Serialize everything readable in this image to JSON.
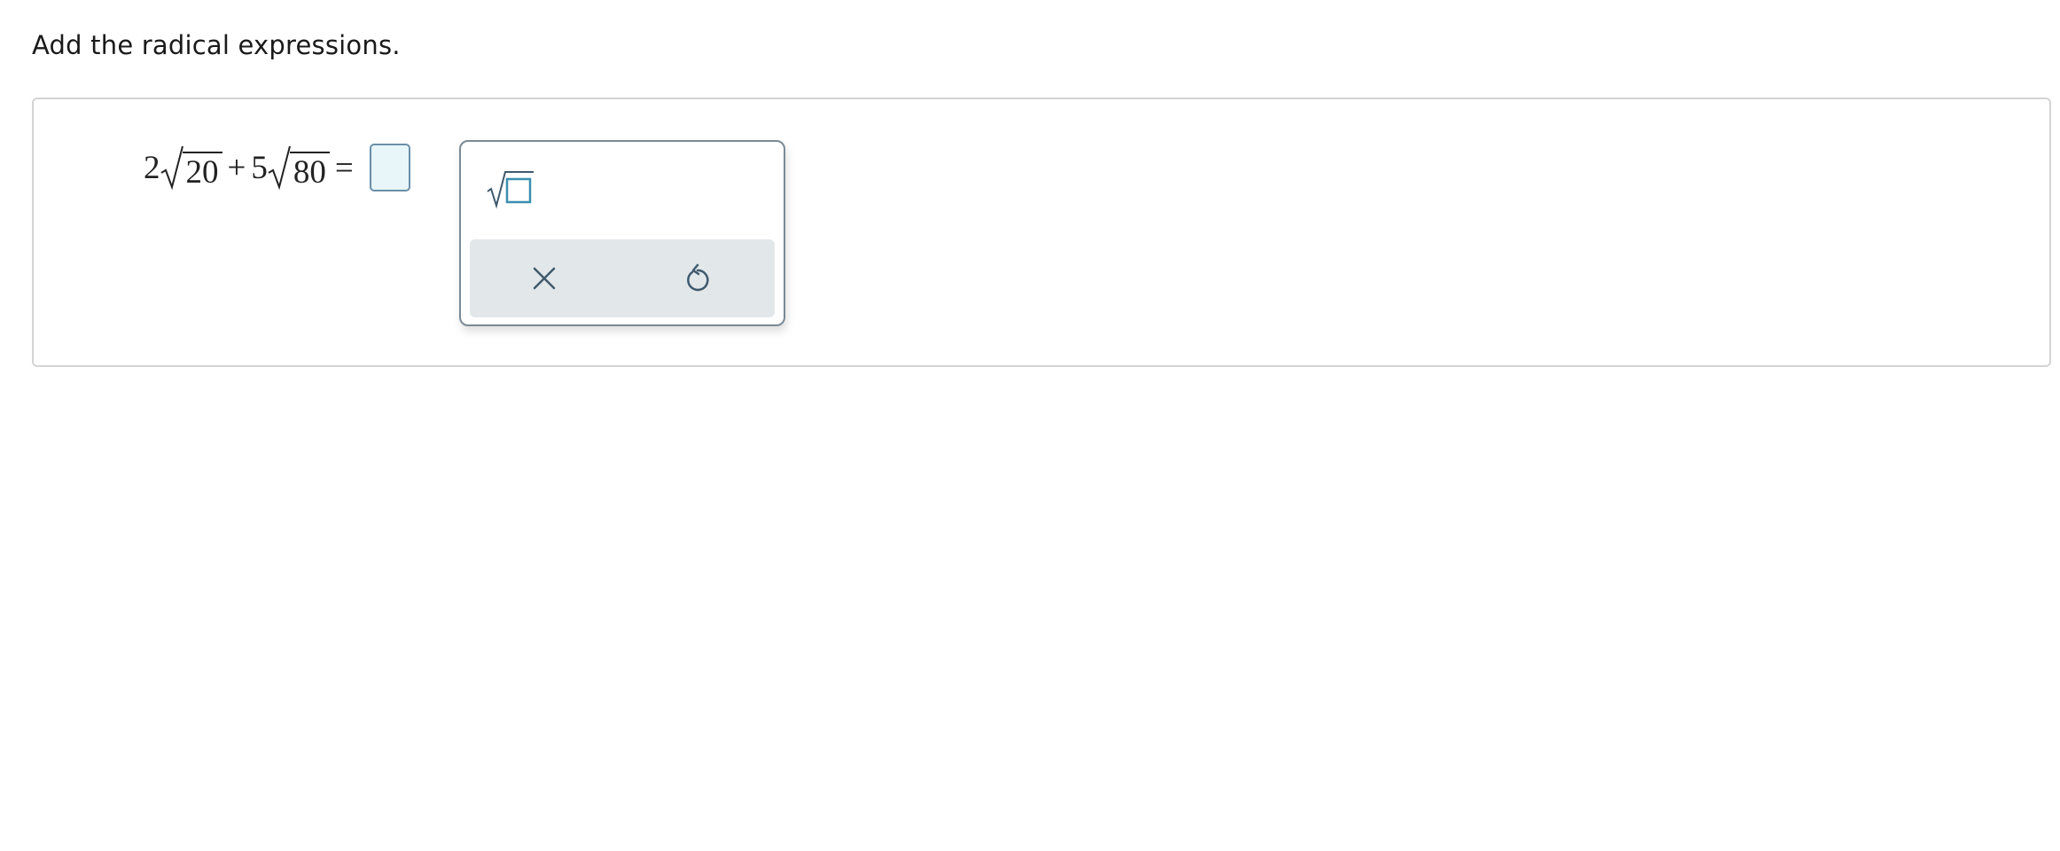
{
  "instruction": "Add the radical expressions.",
  "expression": {
    "coef1": "2",
    "radicand1": "20",
    "plus": "+",
    "coef2": "5",
    "radicand2": "80",
    "equals": "="
  },
  "answer": {
    "value": ""
  },
  "palette": {
    "template_icon": "square-root-template-icon",
    "clear_icon": "x-icon",
    "reset_icon": "undo-icon"
  },
  "colors": {
    "answer_border": "#6a8fa8",
    "answer_fill": "#e8f6f9",
    "template_accent": "#3b8fb0",
    "action_bar": "#e2e7ea",
    "icon_color": "#3f5a6e"
  }
}
